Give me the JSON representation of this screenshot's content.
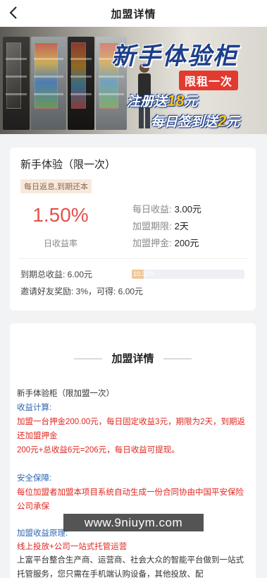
{
  "nav": {
    "title": "加盟详情",
    "back_icon": "chevron-left-icon"
  },
  "banner": {
    "headline": "新手体验柜",
    "tag": "限租一次",
    "line2_prefix": "注册送",
    "line2_num": "18",
    "line2_suffix": "元",
    "line3_prefix": "每日签到送",
    "line3_num": "2",
    "line3_suffix": "元"
  },
  "product": {
    "name": "新手体验（限一次）",
    "badge": "每日返息,到期还本",
    "rate": "1.50%",
    "rate_label": "日收益率",
    "info": [
      {
        "k": "每日收益:",
        "v": "3.00元"
      },
      {
        "k": "加盟期限:",
        "v": "2天"
      },
      {
        "k": "加盟押金:",
        "v": "200元"
      }
    ],
    "total_income": "到期总收益:  6.00元",
    "progress_text": "10.32%",
    "progress_value": 0.1032,
    "invite": "邀请好友奖励:  3%，可得:  6.00元"
  },
  "details": {
    "section_title": "加盟详情",
    "paragraphs": [
      {
        "cls": "black",
        "text": "新手体验柜（限加盟一次）"
      },
      {
        "cls": "blue",
        "text": "收益计算:"
      },
      {
        "cls": "red",
        "text": "加盟一台押金200.00元，每日固定收益3元，期限为2天，到期返还加盟押金"
      },
      {
        "cls": "red",
        "text": "200元+总收益6元=206元，每日收益可提现。"
      },
      {
        "cls": "blue",
        "text": "安全保障:"
      },
      {
        "cls": "red",
        "text": "每位加盟者加盟本项目系统自动生成一份合同协由中国平安保险公司承保"
      },
      {
        "cls": "blue",
        "text": "加盟收益原理:"
      },
      {
        "cls": "red",
        "text": "线上投放+公司一站式托管运营"
      },
      {
        "cls": "black",
        "text": "上富平台整合生产商、运营商、社会大众的智能平台做到一站式托管服务，您只需在手机端认购设备，其他投放、配"
      }
    ]
  },
  "watermark": "www.9niuym.com",
  "colors": {
    "accent_red": "#e2524a",
    "text_red": "#e0261f",
    "text_blue": "#2f66b0",
    "badge_bg": "#f7e9dc"
  }
}
